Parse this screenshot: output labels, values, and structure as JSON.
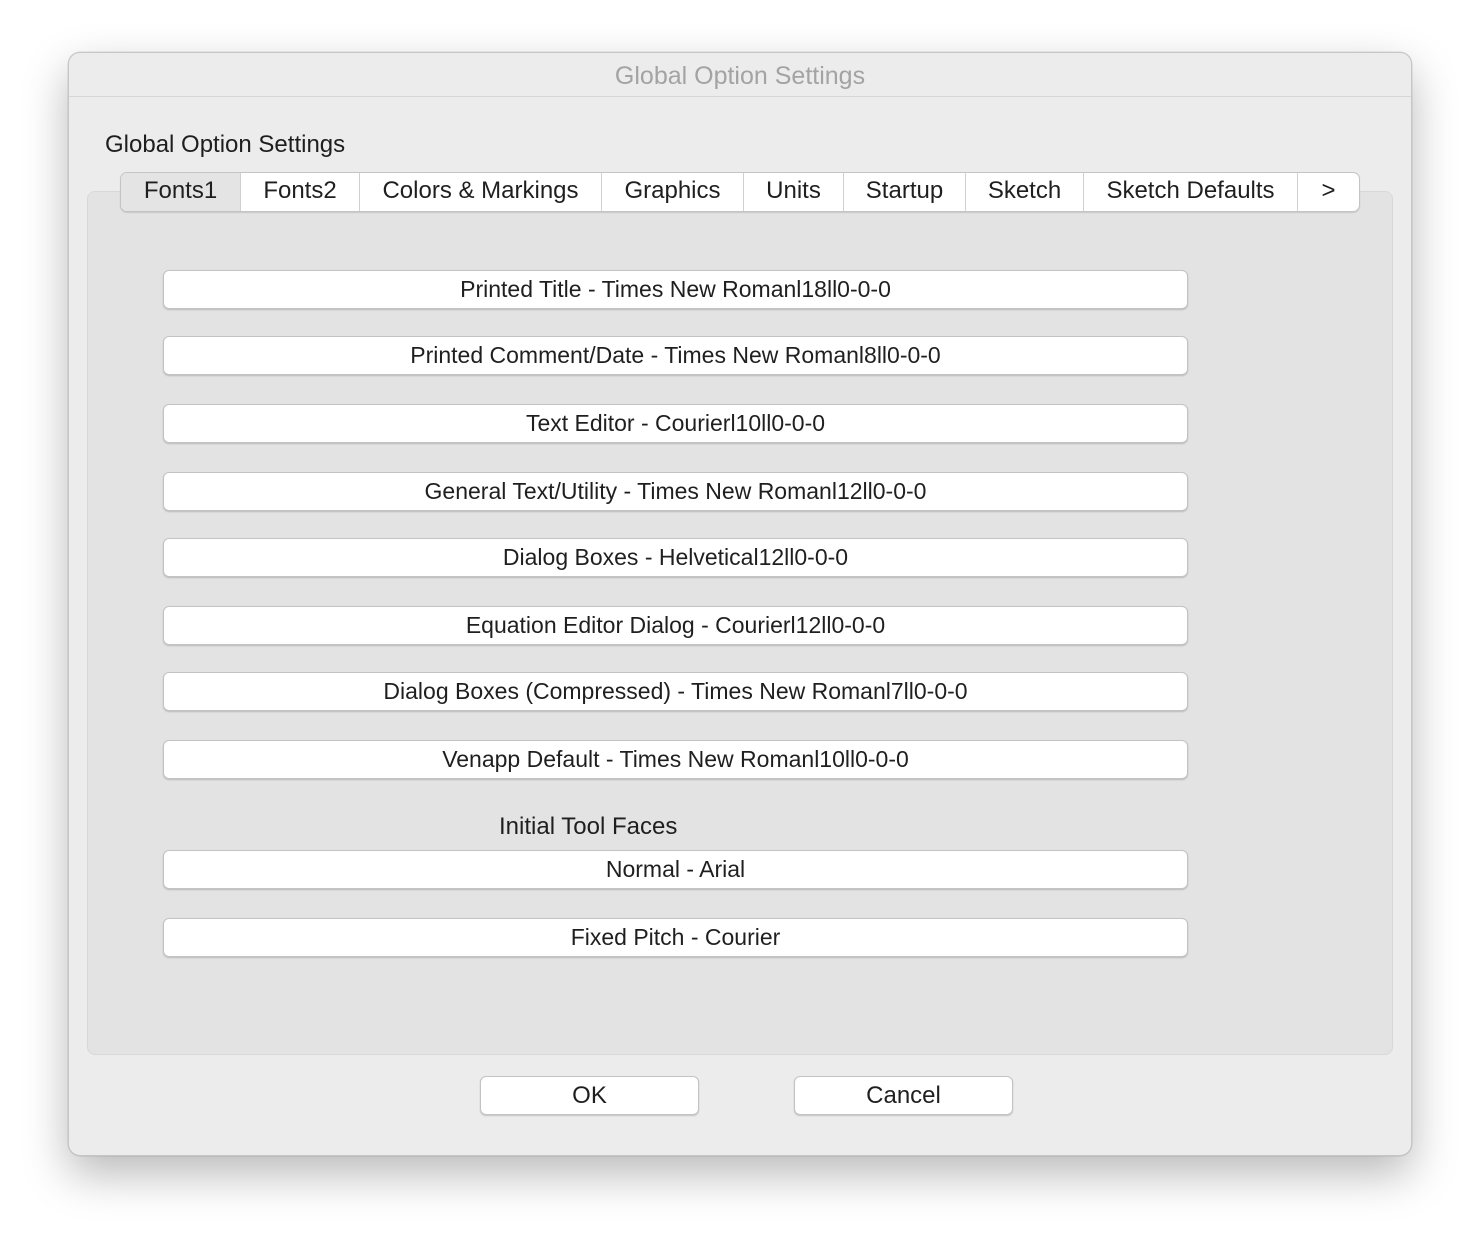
{
  "window": {
    "title": "Global Option Settings"
  },
  "heading": "Global Option Settings",
  "tabs": [
    {
      "label": "Fonts1",
      "selected": true
    },
    {
      "label": "Fonts2",
      "selected": false
    },
    {
      "label": "Colors & Markings",
      "selected": false
    },
    {
      "label": "Graphics",
      "selected": false
    },
    {
      "label": "Units",
      "selected": false
    },
    {
      "label": "Startup",
      "selected": false
    },
    {
      "label": "Sketch",
      "selected": false
    },
    {
      "label": "Sketch Defaults",
      "selected": false
    },
    {
      "label": ">",
      "selected": false
    }
  ],
  "font_settings": [
    "Printed Title - Times New Romanl18ll0-0-0",
    "Printed Comment/Date - Times New Romanl8ll0-0-0",
    "Text Editor - Courierl10ll0-0-0",
    "General Text/Utility - Times New Romanl12ll0-0-0",
    "Dialog Boxes - Helvetical12ll0-0-0",
    "Equation Editor Dialog - Courierl12ll0-0-0",
    "Dialog Boxes (Compressed) - Times New Romanl7ll0-0-0",
    "Venapp Default - Times New Romanl10ll0-0-0"
  ],
  "tool_faces": {
    "heading": "Initial Tool Faces",
    "items": [
      "Normal - Arial",
      "Fixed Pitch - Courier"
    ]
  },
  "buttons": {
    "ok": "OK",
    "cancel": "Cancel"
  }
}
